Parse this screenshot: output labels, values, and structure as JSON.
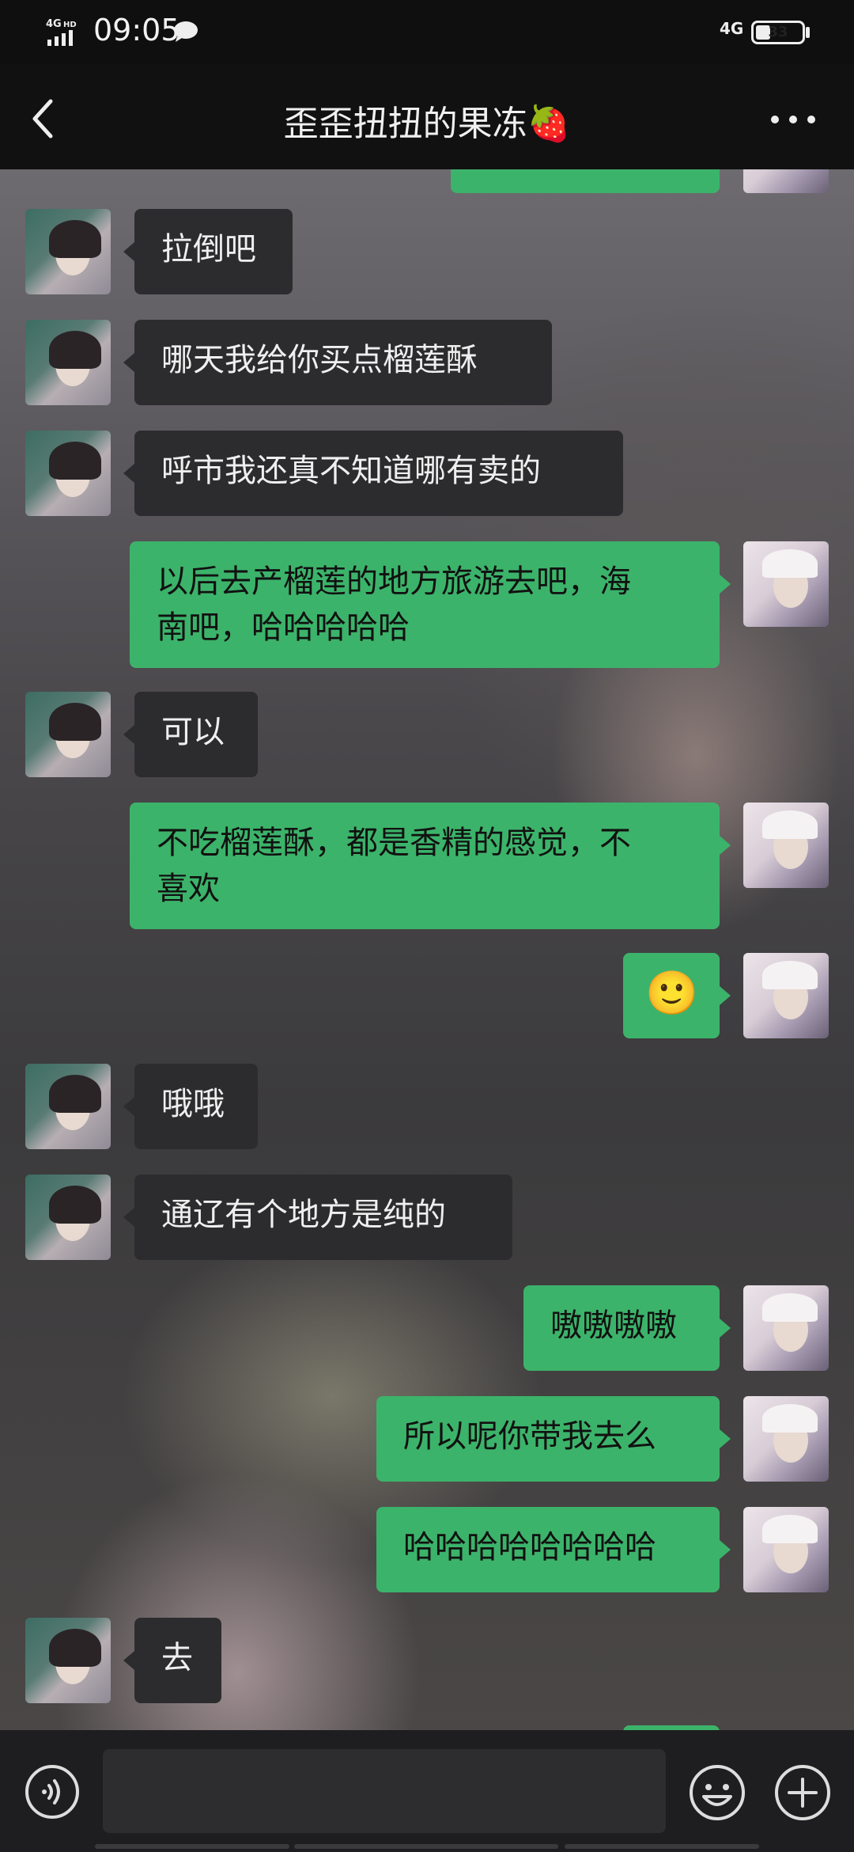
{
  "status_bar": {
    "network_left": "4G HD",
    "time": "09:05",
    "network_right": "4G",
    "battery": "33",
    "battery_level": 0.33
  },
  "header": {
    "title": "歪歪扭扭的果冻🍓"
  },
  "messages": [
    {
      "side": "left",
      "text": "拉倒吧"
    },
    {
      "side": "left",
      "text": "哪天我给你买点榴莲酥"
    },
    {
      "side": "left",
      "text": "呼市我还真不知道哪有卖的"
    },
    {
      "side": "right",
      "text": "以后去产榴莲的地方旅游去吧，海\n南吧，哈哈哈哈哈"
    },
    {
      "side": "left",
      "text": "可以"
    },
    {
      "side": "right",
      "text": "不吃榴莲酥，都是香精的感觉，不\n喜欢"
    },
    {
      "side": "right",
      "text": "🙂"
    },
    {
      "side": "left",
      "text": "哦哦"
    },
    {
      "side": "left",
      "text": "通辽有个地方是纯的"
    },
    {
      "side": "right",
      "text": "嗷嗷嗷嗷"
    },
    {
      "side": "right",
      "text": "所以呢你带我去么"
    },
    {
      "side": "right",
      "text": "哈哈哈哈哈哈哈哈"
    },
    {
      "side": "left",
      "text": "去"
    }
  ],
  "icons": {
    "back": "back-arrow-icon",
    "more": "more-dots-icon",
    "voice": "voice-icon",
    "emoji": "emoji-icon",
    "plus": "plus-icon"
  },
  "colors": {
    "outgoing_bubble": "#3cb36a",
    "incoming_bubble": "#2c2c2e",
    "header_bg": "#111112"
  }
}
